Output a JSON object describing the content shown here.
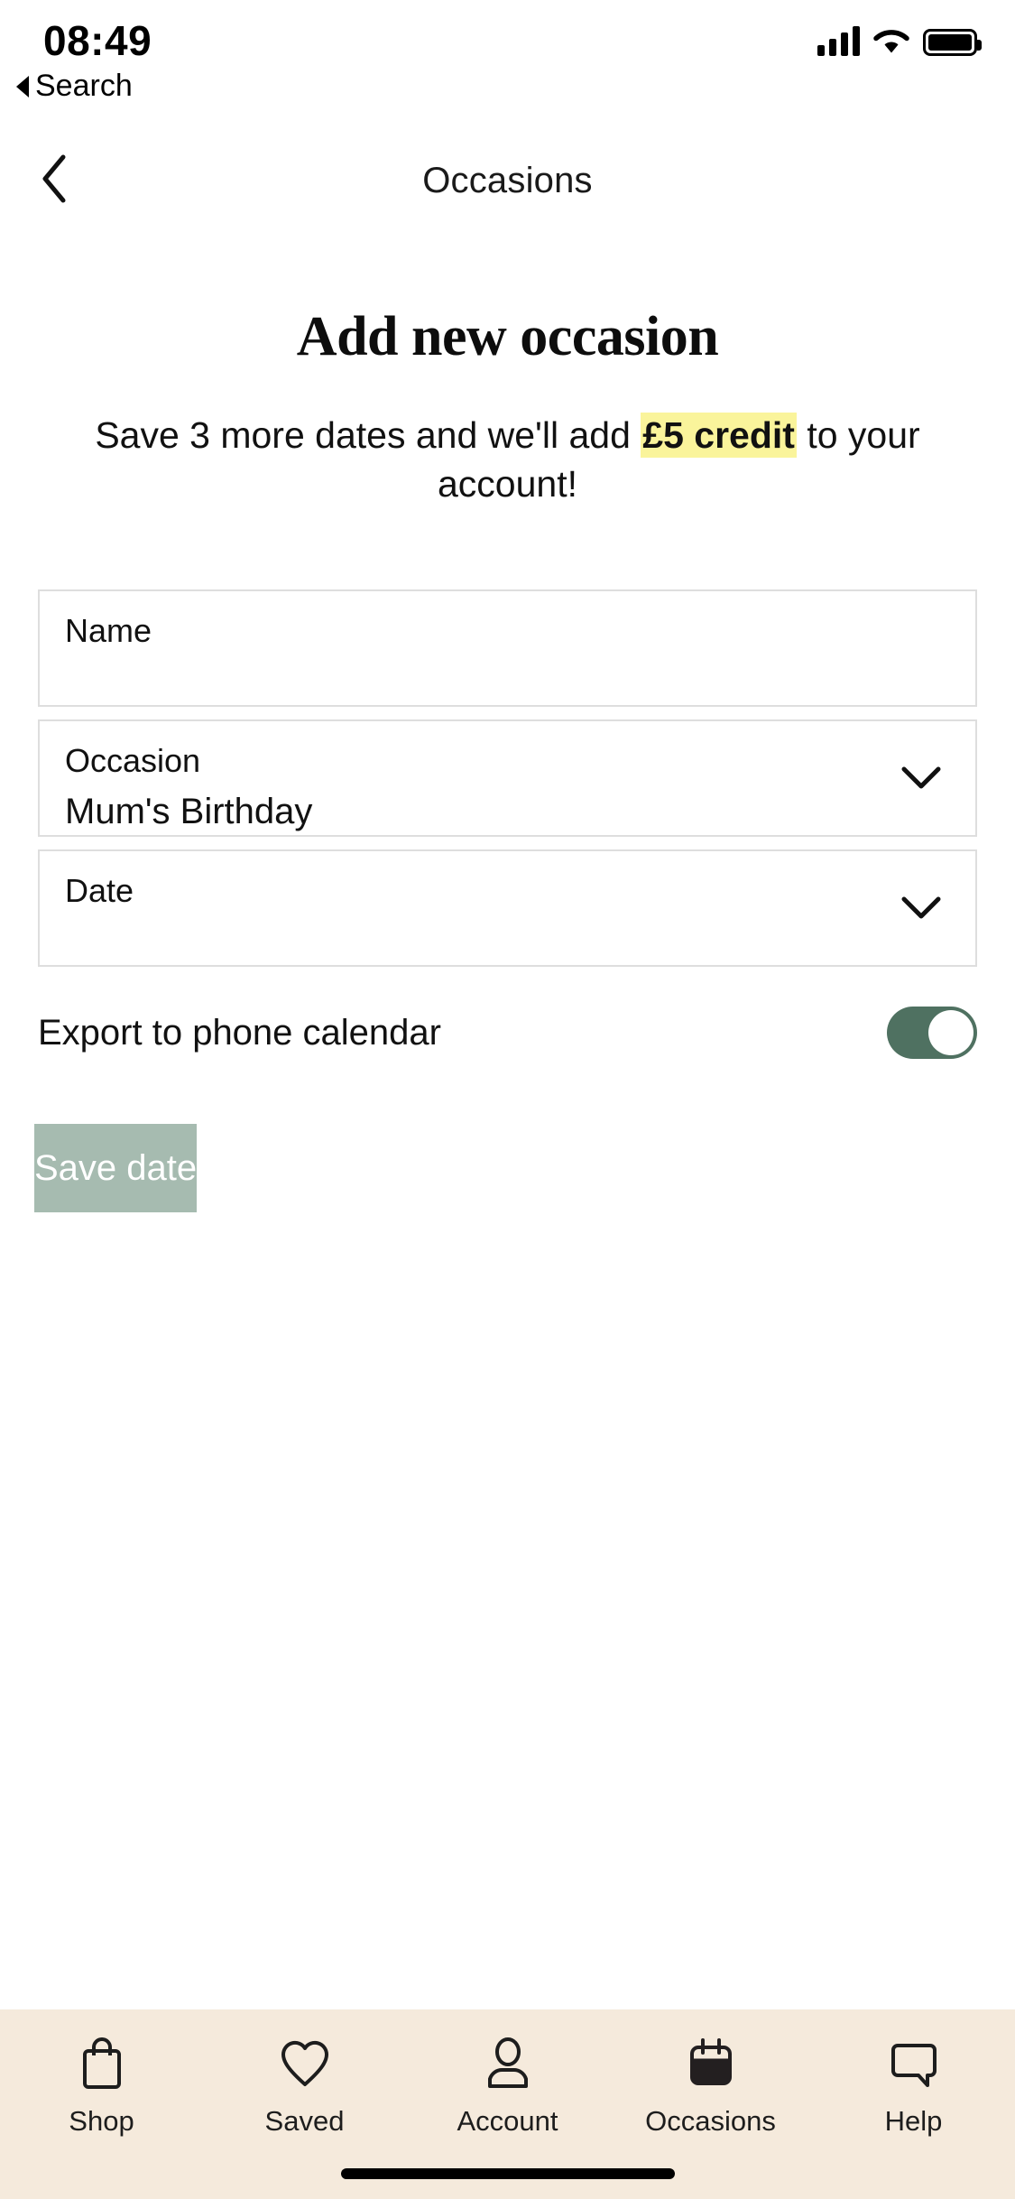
{
  "status_bar": {
    "time": "08:49",
    "back_label": "Search",
    "icons": [
      "signal-icon",
      "wifi-icon",
      "battery-icon"
    ]
  },
  "nav": {
    "title": "Occasions",
    "back_icon": "chevron-left-icon"
  },
  "page": {
    "title": "Add new occasion",
    "promo_before": "Save 3 more dates and we'll add ",
    "promo_highlight": "£5 credit",
    "promo_after": " to your account!"
  },
  "form": {
    "fields": [
      {
        "label": "Name",
        "value": "",
        "icon": ""
      },
      {
        "label": "Occasion",
        "value": "Mum's Birthday",
        "icon": "chevron-down-icon"
      },
      {
        "label": "Date",
        "value": "",
        "icon": "chevron-down-icon"
      }
    ],
    "toggle": {
      "label": "Export to phone calendar",
      "state": "on"
    },
    "submit_label": "Save date"
  },
  "colors": {
    "highlight": "#FAF49B",
    "toggle_on": "#4F7161",
    "button_disabled": "#A6BBB0",
    "tabbar_bg": "#F5EADC",
    "field_border": "#DEDEDE"
  },
  "tabbar": {
    "items": [
      {
        "label": "Shop",
        "icon": "shopping-bag-icon",
        "active": false
      },
      {
        "label": "Saved",
        "icon": "heart-icon",
        "active": false
      },
      {
        "label": "Account",
        "icon": "person-icon",
        "active": false
      },
      {
        "label": "Occasions",
        "icon": "calendar-icon",
        "active": true
      },
      {
        "label": "Help",
        "icon": "speech-bubble-icon",
        "active": false
      }
    ]
  }
}
